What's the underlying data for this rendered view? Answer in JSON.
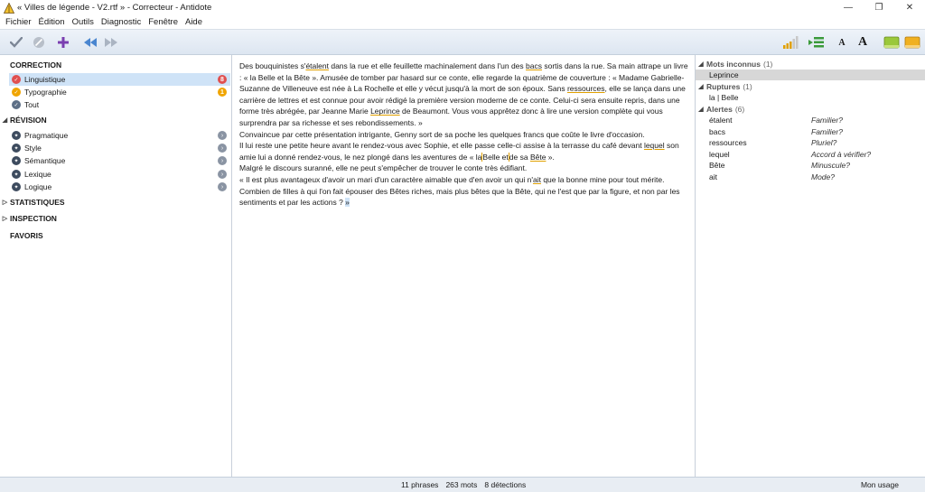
{
  "window": {
    "title": "« Villes de légende - V2.rtf » - Correcteur - Antidote",
    "minimize": "—",
    "maximize": "❐",
    "close": "✕"
  },
  "menu": [
    "Fichier",
    "Édition",
    "Outils",
    "Diagnostic",
    "Fenêtre",
    "Aide"
  ],
  "toolbar": {
    "left_icons": [
      "check-icon",
      "cancel-icon",
      "plus-icon",
      "rewind-icon",
      "forward-icon"
    ],
    "right_icons": [
      "signal-bars-icon",
      "list-swap-icon",
      "font-smaller-icon",
      "font-larger-icon",
      "panel-left-icon",
      "panel-right-icon"
    ],
    "font_small": "A",
    "font_large": "A"
  },
  "colors": {
    "accent": "#6b8fc6",
    "selected_bg": "#cfe3f7",
    "alert_red": "#e05050",
    "alert_orange": "#f0a500",
    "underline": "#e0a000"
  },
  "sidebar": {
    "correction": {
      "title": "CORRECTION",
      "items": [
        {
          "label": "Linguistique",
          "badge": "8",
          "icon": "linguistique-icon",
          "color": "#e05050"
        },
        {
          "label": "Typographie",
          "badge": "1",
          "icon": "typographie-icon",
          "color": "#f0a500"
        },
        {
          "label": "Tout",
          "badge": "",
          "icon": "tout-icon",
          "color": "#5d6f86"
        }
      ]
    },
    "revision": {
      "title": "RÉVISION",
      "items": [
        {
          "label": "Pragmatique"
        },
        {
          "label": "Style"
        },
        {
          "label": "Sémantique"
        },
        {
          "label": "Lexique"
        },
        {
          "label": "Logique"
        }
      ]
    },
    "statistiques": "STATISTIQUES",
    "inspection": "INSPECTION",
    "favoris": "FAVORIS"
  },
  "document": {
    "p1": {
      "a": "Des bouquinistes s'",
      "b": "étalent",
      "c": " dans la rue et elle feuillette machinalement dans l'un des ",
      "d": "bacs",
      "e": " sortis dans la rue. Sa main attrape un livre : « la Belle et la Bête ». Amusée de tomber par hasard sur ce conte, elle regarde la quatrième de couverture : « Madame Gabrielle-Suzanne de Villeneuve est née à La Rochelle et elle y vécut jusqu'à la mort de son époux. Sans ",
      "f": "ressources",
      "g": ", elle se lança dans une carrière de lettres et est connue pour avoir rédigé la première version moderne de ce conte. Celui-ci sera ensuite repris, dans une forme très abrégée, par Jeanne Marie ",
      "h": "Leprince",
      "i": " de Beaumont. Vous vous apprêtez donc à lire une version complète qui vous surprendra par sa richesse et ses rebondissements. »"
    },
    "p2": "Convaincue par cette présentation intrigante, Genny sort de sa poche les quelques francs que coûte le livre d'occasion.",
    "p3": {
      "a": "Il lui reste une petite heure avant le rendez-vous avec Sophie, et elle passe celle-ci assise à la terrasse du café devant ",
      "b": "lequel",
      "c": " son amie lui a donné rendez-vous, le nez plongé dans les aventures de « ",
      "d": "la",
      "e": "Belle et",
      "f": "de sa ",
      "g": "Bête",
      "h": " »."
    },
    "p4": "Malgré le discours suranné, elle ne peut s'empêcher de trouver le conte très édifiant.",
    "p5": {
      "a": "« Il est plus avantageux d'avoir un mari d'un caractère aimable que d'en avoir un qui n'",
      "b": "ait",
      "c": " que la bonne mine pour tout mérite. Combien de filles à qui l'on fait épouser des Bêtes riches, mais plus bêtes que la Bête, qui ne l'est que par la figure, et non par les sentiments et par les actions ? ",
      "d": "»"
    }
  },
  "detections": {
    "mots_inconnus": {
      "title": "Mots inconnus",
      "count": "(1)",
      "items": [
        "Leprince"
      ]
    },
    "ruptures": {
      "title": "Ruptures",
      "count": "(1)",
      "items": [
        "la | Belle"
      ]
    },
    "alertes": {
      "title": "Alertes",
      "count": "(6)",
      "items": [
        {
          "term": "étalent",
          "note": "Familier?"
        },
        {
          "term": "bacs",
          "note": "Familier?"
        },
        {
          "term": "ressources",
          "note": "Pluriel?"
        },
        {
          "term": "lequel",
          "note": "Accord à vérifier?"
        },
        {
          "term": "Bête",
          "note": "Minuscule?"
        },
        {
          "term": "ait",
          "note": "Mode?"
        }
      ]
    }
  },
  "status": {
    "phrases": "11 phrases",
    "mots": "263 mots",
    "detections": "8 détections",
    "usage": "Mon usage"
  }
}
